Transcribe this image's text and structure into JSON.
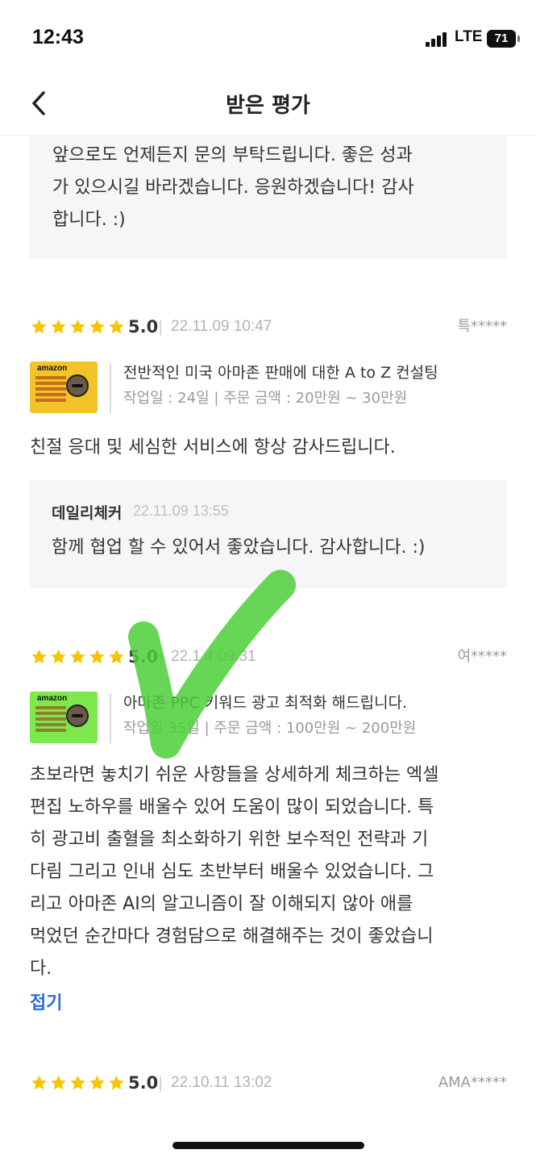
{
  "status_bar": {
    "time": "12:43",
    "network": "LTE",
    "battery": "71"
  },
  "header": {
    "title": "받은 평가"
  },
  "top_reply": {
    "lines": [
      "앞으로도 언제든지 문의 부탁드립니다. 좋은 성과",
      "가 있으시길 바라겠습니다. 응원하겠습니다! 감사",
      "합니다. :)"
    ]
  },
  "reviews": [
    {
      "rating": "5.0",
      "rating_value": 5,
      "date": "22.11.09 10:47",
      "author": "특*****",
      "gig": {
        "thumb_brand": "amazon",
        "thumb_color": "#f2c428",
        "title": "전반적인 미국 아마존 판매에 대한 A to Z 컨설팅",
        "meta": "작업일 : 24일 | 주문 금액 : 20만원 ~ 30만원"
      },
      "body_lines": [
        "친절 응대 및 세심한 서비스에 항상 감사드립니다."
      ],
      "seller_reply": {
        "name": "데일리체커",
        "date": "22.11.09 13:55",
        "text": "함께 협업 할 수 있어서 좋았습니다. 감사합니다. :)"
      }
    },
    {
      "rating": "5.0",
      "rating_value": 5,
      "date": "22.1 4 09:31",
      "author": "여*****",
      "gig": {
        "thumb_brand": "amazon",
        "thumb_color": "#7de84a",
        "title": "아마존 PPC 키워드 광고 최적화 해드립니다.",
        "meta": "작업일 35일 | 주문 금액 : 100만원 ~ 200만원"
      },
      "body_lines": [
        "초보라면 놓치기 쉬운 사항들을 상세하게 체크하는 엑셀",
        "편집 노하우를 배울수 있어 도움이 많이 되었습니다. 특",
        "히 광고비 출혈을 최소화하기 위한 보수적인 전략과 기",
        "다림 그리고 인내 심도 초반부터 배울수 있었습니다. 그",
        "리고  아마존 AI의 알고니즘이 잘 이해되지 않아 애를",
        "먹었던 순간마다 경험담으로 해결해주는 것이 좋았습니",
        "다."
      ],
      "fold_label": "접기"
    },
    {
      "rating": "5.0",
      "rating_value": 5,
      "date": "22.10.11 13:02",
      "author": "AMA*****"
    }
  ],
  "colors": {
    "star": "#f7c600",
    "accent_link": "#2f6fd6",
    "check_mark": "#4ccf3a"
  }
}
